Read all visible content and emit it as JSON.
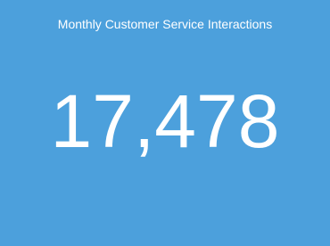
{
  "chart_data": {
    "type": "table",
    "title": "Monthly Customer Service Interactions",
    "value": 17478,
    "value_label": "17,478"
  },
  "colors": {
    "card_background": "#4ca0dc",
    "text": "#ffffff"
  }
}
